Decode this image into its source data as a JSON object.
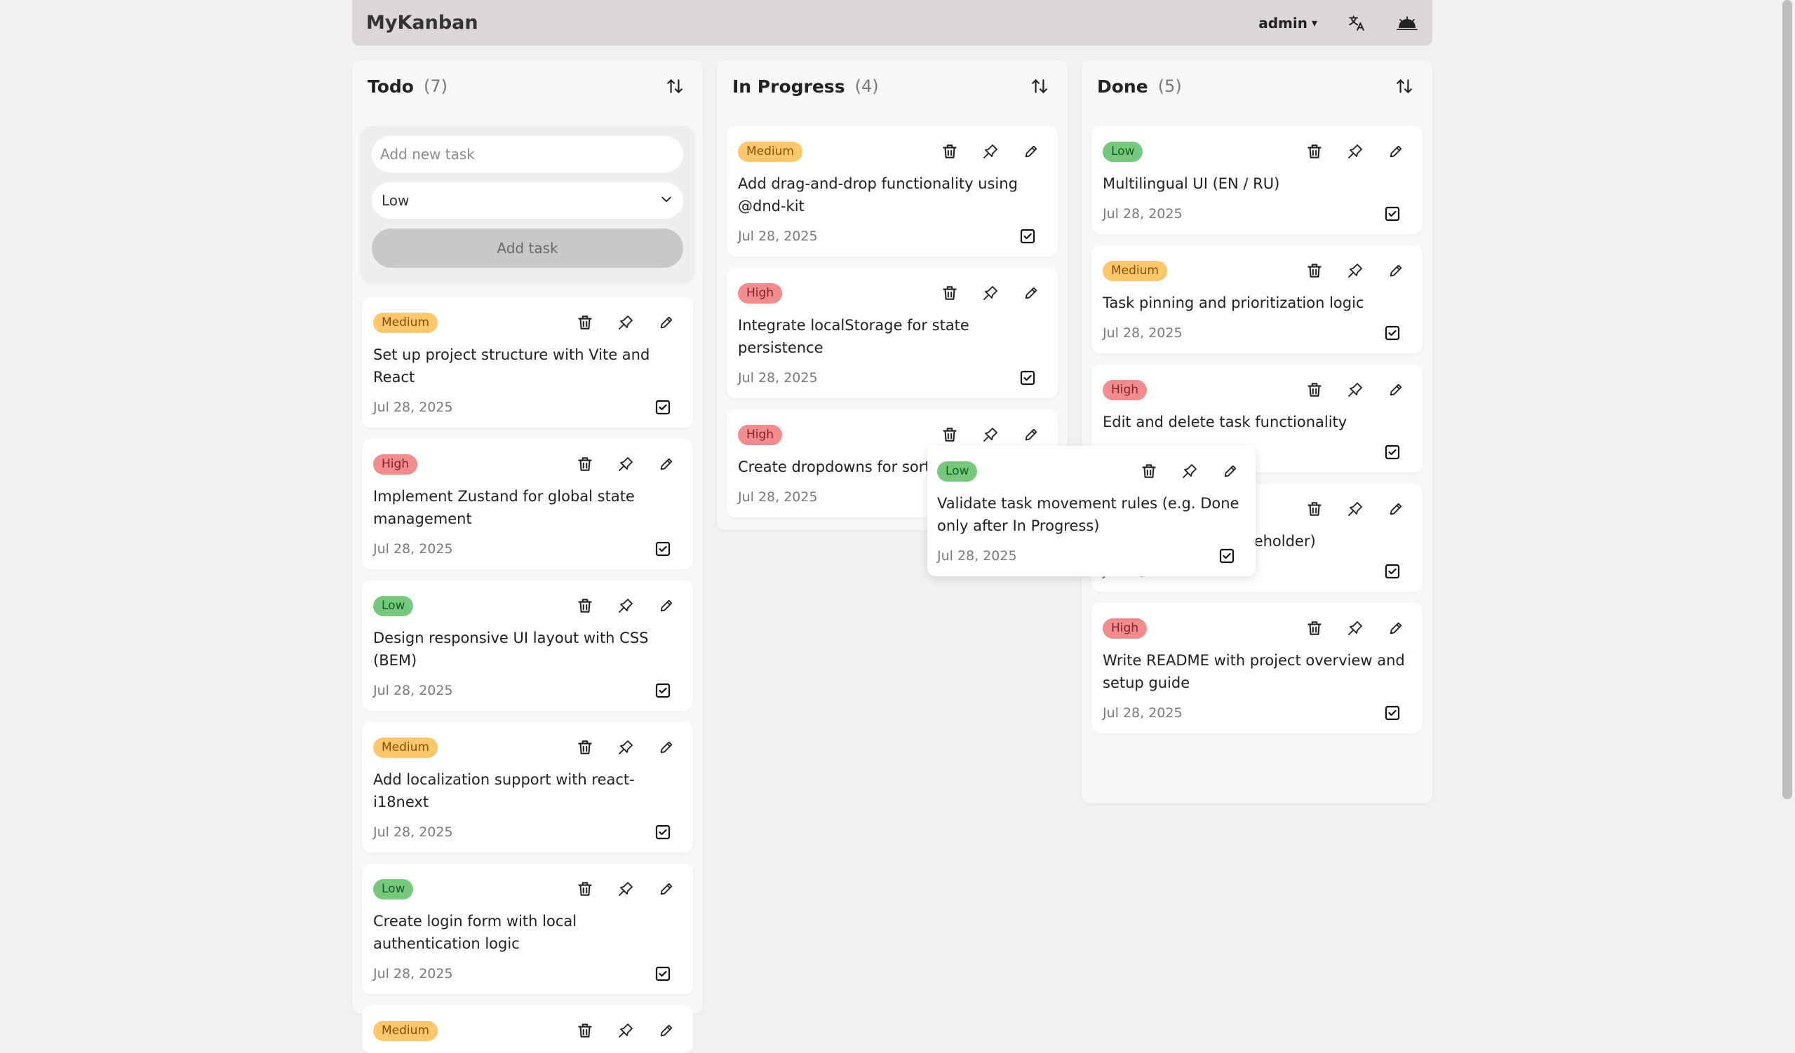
{
  "app": {
    "title": "MyKanban"
  },
  "header": {
    "user": "admin",
    "user_caret": "▾"
  },
  "columns": [
    {
      "title": "Todo",
      "count": "(7)",
      "add_form": {
        "placeholder": "Add new task",
        "priority_value": "Low",
        "button_label": "Add task"
      },
      "cards": [
        {
          "priority": "Medium",
          "level": "medium",
          "title": "Set up project structure with Vite and React",
          "date": "Jul 28, 2025"
        },
        {
          "priority": "High",
          "level": "high",
          "title": "Implement Zustand for global state management",
          "date": "Jul 28, 2025"
        },
        {
          "priority": "Low",
          "level": "low",
          "title": "Design responsive UI layout with CSS (BEM)",
          "date": "Jul 28, 2025"
        },
        {
          "priority": "Medium",
          "level": "medium",
          "title": "Add localization support with react-i18next",
          "date": "Jul 28, 2025"
        },
        {
          "priority": "Low",
          "level": "low",
          "title": "Create login form with local authentication logic",
          "date": "Jul 28, 2025"
        },
        {
          "priority": "Medium",
          "level": "medium",
          "title": "",
          "date": ""
        }
      ]
    },
    {
      "title": "In Progress",
      "count": "(4)",
      "cards": [
        {
          "priority": "Medium",
          "level": "medium",
          "title": "Add drag-and-drop functionality using @dnd-kit",
          "date": "Jul 28, 2025"
        },
        {
          "priority": "High",
          "level": "high",
          "title": "Integrate localStorage for state persistence",
          "date": "Jul 28, 2025"
        },
        {
          "priority": "High",
          "level": "high",
          "title": "Create dropdowns for sortin",
          "date": "Jul 28, 2025"
        }
      ]
    },
    {
      "title": "Done",
      "count": "(5)",
      "cards": [
        {
          "priority": "Low",
          "level": "low",
          "title": "Multilingual UI (EN / RU)",
          "date": "Jul 28, 2025"
        },
        {
          "priority": "Medium",
          "level": "medium",
          "title": "Task pinning and prioritization logic",
          "date": "Jul 28, 2025"
        },
        {
          "priority": "High",
          "level": "high",
          "title": "Edit and delete task functionality",
          "date": ""
        },
        {
          "priority": "",
          "level": "low",
          "title": "with axios (JSONPlaceholder)",
          "date": "Jul 28, 2025"
        },
        {
          "priority": "High",
          "level": "high",
          "title": "Write README with project overview and setup guide",
          "date": "Jul 28, 2025"
        }
      ]
    }
  ],
  "dragging_card": {
    "priority": "Low",
    "level": "low",
    "title": "Validate task movement rules (e.g. Done only after In Progress)",
    "date": "Jul 28, 2025"
  },
  "icons": {
    "language": "translate-icon",
    "theme": "theme-toggle-icon",
    "sort": "sort-arrows-icon",
    "delete": "trash-icon",
    "pin": "pin-icon",
    "edit": "pencil-icon",
    "complete": "checkbox-checked-icon",
    "dropdown": "chevron-down-icon"
  }
}
